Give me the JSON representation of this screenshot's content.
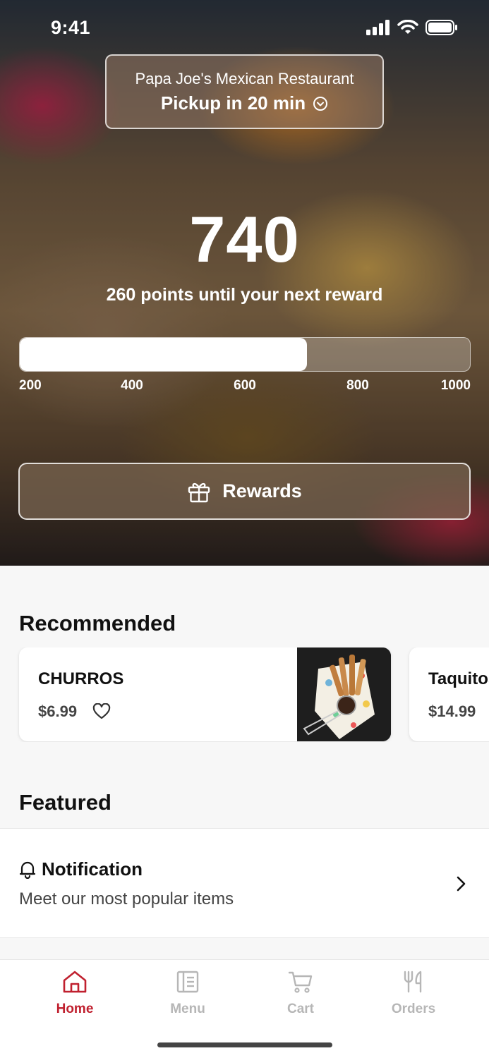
{
  "status_bar": {
    "time": "9:41"
  },
  "restaurant": {
    "name": "Papa Joe's Mexican Restaurant",
    "pickup": "Pickup in 20 min"
  },
  "loyalty": {
    "points": "740",
    "subtitle": "260 points until your next reward",
    "progress_fraction": 0.638,
    "ticks": [
      "200",
      "400",
      "600",
      "800",
      "1000"
    ]
  },
  "rewards_button": {
    "label": "Rewards"
  },
  "recommended": {
    "title": "Recommended",
    "items": [
      {
        "name": "CHURROS",
        "price": "$6.99"
      },
      {
        "name": "Taquitos",
        "price": "$14.99"
      }
    ]
  },
  "featured": {
    "title": "Featured",
    "item": {
      "heading": "Notification",
      "description": "Meet our most popular items"
    }
  },
  "tabs": [
    {
      "label": "Home",
      "icon": "home-icon",
      "active": true
    },
    {
      "label": "Menu",
      "icon": "menu-icon",
      "active": false
    },
    {
      "label": "Cart",
      "icon": "cart-icon",
      "active": false
    },
    {
      "label": "Orders",
      "icon": "fork-knife-icon",
      "active": false
    }
  ],
  "colors": {
    "accent": "#c0202f",
    "inactive_tab": "#b6b6b6"
  }
}
